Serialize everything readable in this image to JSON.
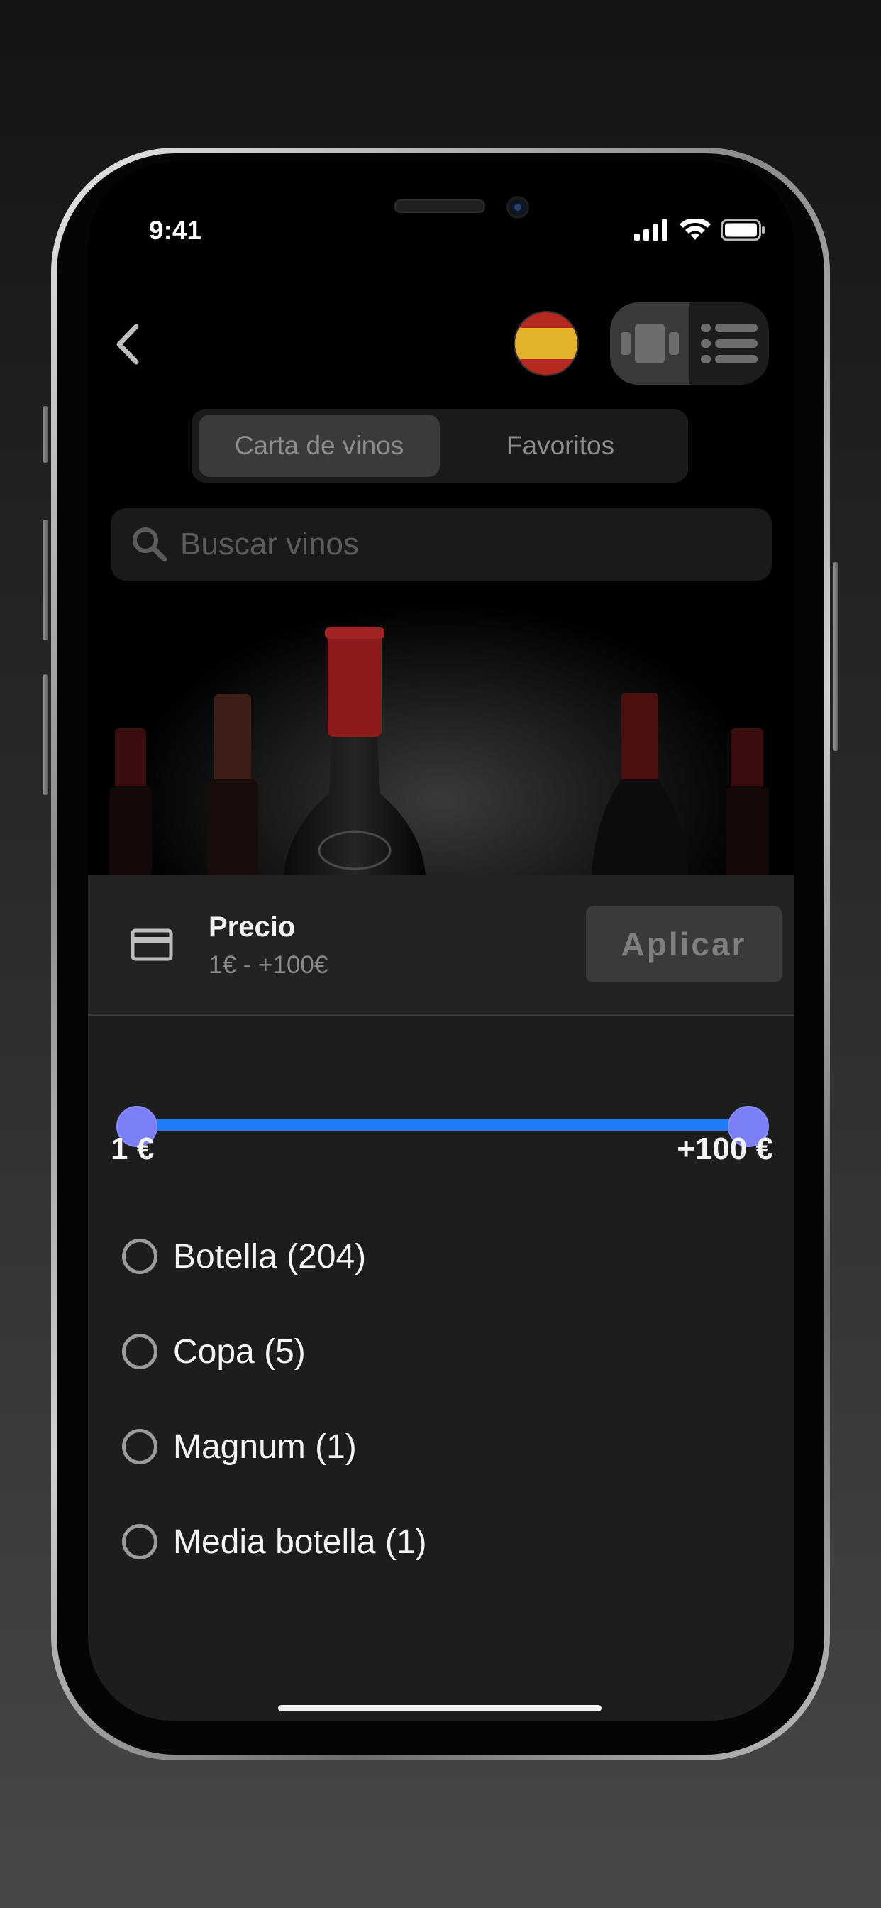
{
  "status_bar": {
    "time": "9:41"
  },
  "top_bar": {
    "language_flag": "spain-flag-icon"
  },
  "tabs": [
    {
      "label": "Carta de vinos",
      "active": true
    },
    {
      "label": "Favoritos",
      "active": false
    }
  ],
  "search": {
    "placeholder": "Buscar vinos",
    "value": ""
  },
  "filter_sheet": {
    "title": "Precio",
    "range_text": "1€ - +100€",
    "apply_label": "Aplicar",
    "slider": {
      "min_label": "1 €",
      "max_label": "+100 €",
      "low_fraction": 0.0,
      "high_fraction": 1.0
    },
    "options": [
      {
        "label": "Botella (204)",
        "selected": false
      },
      {
        "label": "Copa (5)",
        "selected": false
      },
      {
        "label": "Magnum (1)",
        "selected": false
      },
      {
        "label": "Media botella (1)",
        "selected": false
      }
    ]
  },
  "colors": {
    "accent": "#1e7ef5",
    "thumb": "#7b7ff5",
    "sheet_bg": "#1d1d1d"
  }
}
